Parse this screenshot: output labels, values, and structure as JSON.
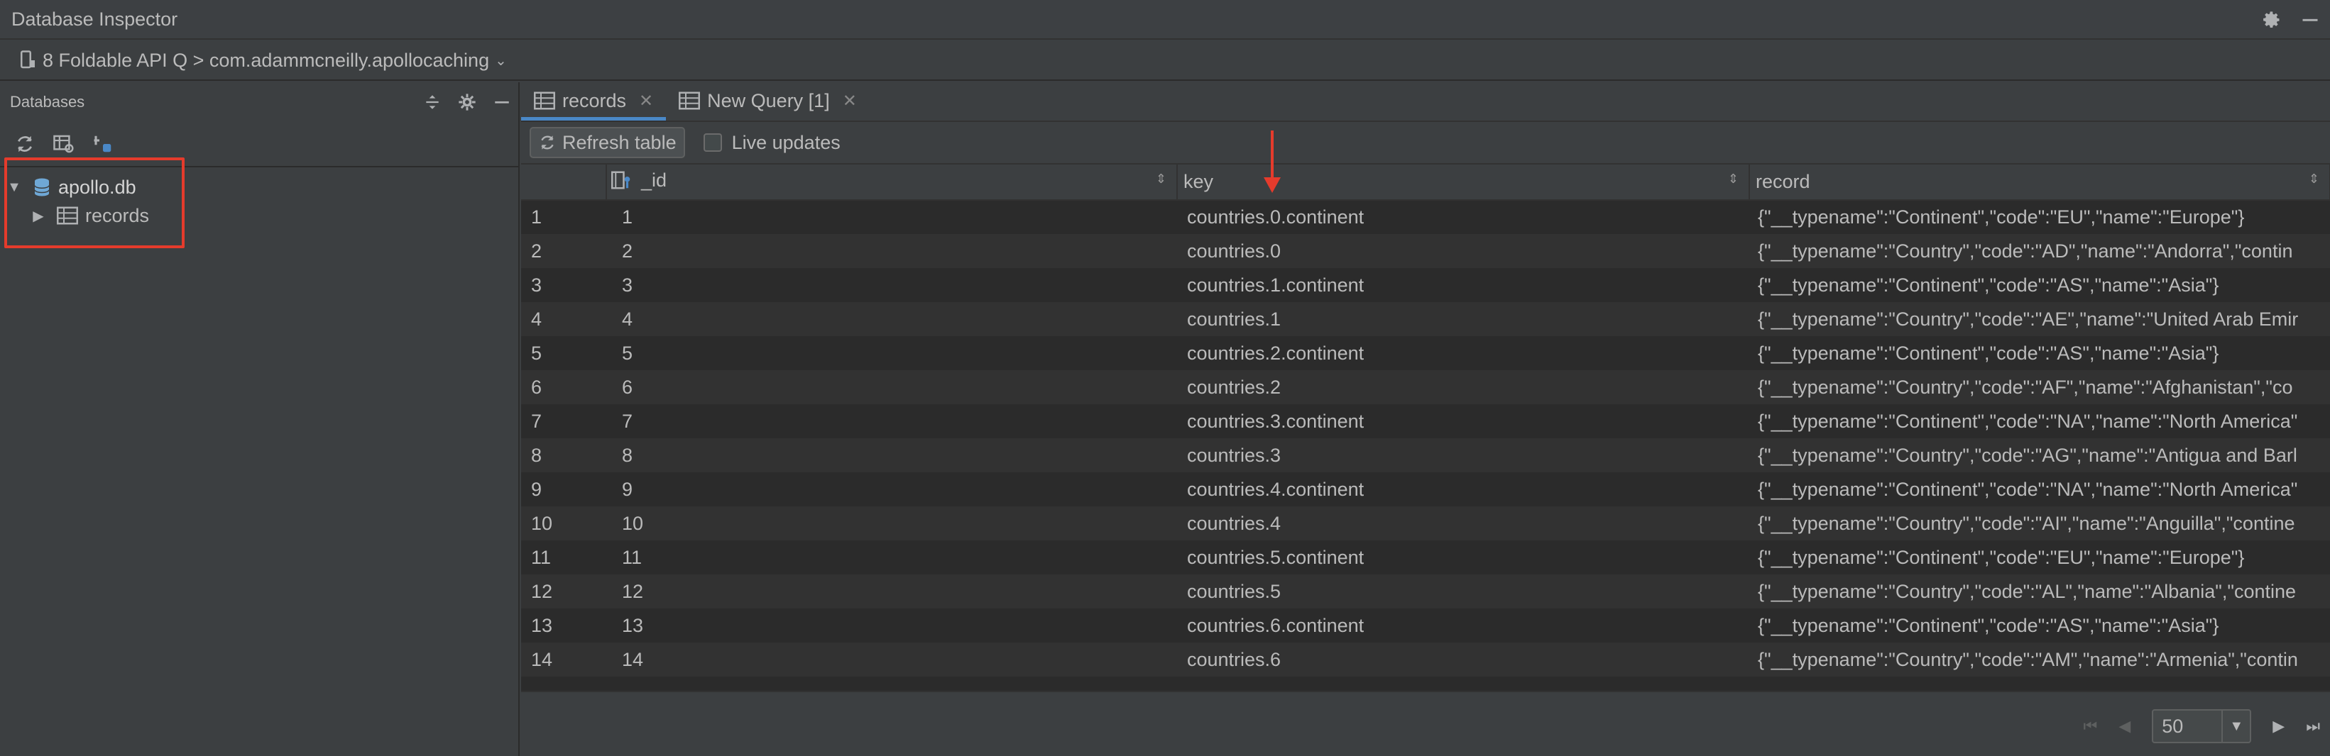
{
  "window": {
    "title": "Database Inspector"
  },
  "device": {
    "label": "8 Foldable API Q > com.adammcneilly.apollocaching"
  },
  "databases_panel": {
    "header": "Databases",
    "tree": {
      "db_name": "apollo.db",
      "tables": [
        {
          "name": "records"
        }
      ]
    }
  },
  "tabs": [
    {
      "label": "records",
      "active": true
    },
    {
      "label": "New Query [1]",
      "active": false
    }
  ],
  "toolbar": {
    "refresh_label": "Refresh table",
    "live_updates_label": "Live updates",
    "live_updates_checked": false
  },
  "table": {
    "columns": [
      "_id",
      "key",
      "record"
    ],
    "rows": [
      {
        "n": "1",
        "id": "1",
        "key": "countries.0.continent",
        "record": "{\"__typename\":\"Continent\",\"code\":\"EU\",\"name\":\"Europe\"}"
      },
      {
        "n": "2",
        "id": "2",
        "key": "countries.0",
        "record": "{\"__typename\":\"Country\",\"code\":\"AD\",\"name\":\"Andorra\",\"contin"
      },
      {
        "n": "3",
        "id": "3",
        "key": "countries.1.continent",
        "record": "{\"__typename\":\"Continent\",\"code\":\"AS\",\"name\":\"Asia\"}"
      },
      {
        "n": "4",
        "id": "4",
        "key": "countries.1",
        "record": "{\"__typename\":\"Country\",\"code\":\"AE\",\"name\":\"United Arab Emir"
      },
      {
        "n": "5",
        "id": "5",
        "key": "countries.2.continent",
        "record": "{\"__typename\":\"Continent\",\"code\":\"AS\",\"name\":\"Asia\"}"
      },
      {
        "n": "6",
        "id": "6",
        "key": "countries.2",
        "record": "{\"__typename\":\"Country\",\"code\":\"AF\",\"name\":\"Afghanistan\",\"co"
      },
      {
        "n": "7",
        "id": "7",
        "key": "countries.3.continent",
        "record": "{\"__typename\":\"Continent\",\"code\":\"NA\",\"name\":\"North America\""
      },
      {
        "n": "8",
        "id": "8",
        "key": "countries.3",
        "record": "{\"__typename\":\"Country\",\"code\":\"AG\",\"name\":\"Antigua and Barl"
      },
      {
        "n": "9",
        "id": "9",
        "key": "countries.4.continent",
        "record": "{\"__typename\":\"Continent\",\"code\":\"NA\",\"name\":\"North America\""
      },
      {
        "n": "10",
        "id": "10",
        "key": "countries.4",
        "record": "{\"__typename\":\"Country\",\"code\":\"AI\",\"name\":\"Anguilla\",\"contine"
      },
      {
        "n": "11",
        "id": "11",
        "key": "countries.5.continent",
        "record": "{\"__typename\":\"Continent\",\"code\":\"EU\",\"name\":\"Europe\"}"
      },
      {
        "n": "12",
        "id": "12",
        "key": "countries.5",
        "record": "{\"__typename\":\"Country\",\"code\":\"AL\",\"name\":\"Albania\",\"contine"
      },
      {
        "n": "13",
        "id": "13",
        "key": "countries.6.continent",
        "record": "{\"__typename\":\"Continent\",\"code\":\"AS\",\"name\":\"Asia\"}"
      },
      {
        "n": "14",
        "id": "14",
        "key": "countries.6",
        "record": "{\"__typename\":\"Country\",\"code\":\"AM\",\"name\":\"Armenia\",\"contin"
      }
    ]
  },
  "pagination": {
    "page_size": "50"
  },
  "colors": {
    "annotation_red": "#e53b2c",
    "accent_blue": "#4a88c7",
    "db_icon_blue": "#6fa8d6"
  }
}
